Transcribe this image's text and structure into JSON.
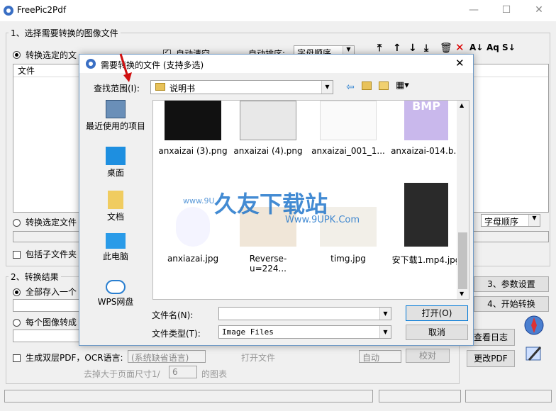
{
  "window": {
    "title": "FreePic2Pdf"
  },
  "section1": {
    "label": "1、选择需要转换的图像文件",
    "radio_selected": "转换选定的文",
    "auto_clear": "自动清空",
    "auto_sort_label": "自动排序:",
    "sort_value": "字母顺序",
    "file_column": "文件",
    "radio_folder": "转换选定文件",
    "include_subfolders": "包括子文件夹",
    "sort_value2": "字母顺序"
  },
  "section2": {
    "label": "2、转换结果",
    "all_into_one": "全部存入一个",
    "each_image": "每个图像转成",
    "dual_layer": "生成双层PDF，OCR语言:",
    "ocr_lang": "(系统缺省语言)",
    "open_file": "打开文件",
    "auto": "自动",
    "calibrate": "校对",
    "remove_larger": "去掉大于页面尺寸1/",
    "remove_value": "6",
    "remove_suffix": "的图表"
  },
  "buttons": {
    "params": "3、参数设置",
    "start": "4、开始转换",
    "log": "查看日志",
    "modify": "更改PDF"
  },
  "dialog": {
    "title": "需要转换的文件 (支持多选)",
    "lookin_label": "查找范围(I):",
    "lookin_value": "说明书",
    "places": [
      "最近使用的项目",
      "桌面",
      "文档",
      "此电脑",
      "WPS网盘"
    ],
    "files": [
      "anxaizai (3).png",
      "anxaizai (4).png",
      "anxaizai_001_1...",
      "anxaizai-014.b...",
      "anxiazai.jpg",
      "Reverse-u=224...",
      "timg.jpg",
      "安下载1.mp4.jpg"
    ],
    "bmp_badge": "BMP",
    "filename_label": "文件名(N):",
    "filename_value": "",
    "filetype_label": "文件类型(T):",
    "filetype_value": "Image Files",
    "open_button": "打开(O)",
    "cancel_button": "取消"
  },
  "watermark": {
    "main": "久友下载站",
    "sub": "Www.9UPK.Com",
    "left": "www.9U"
  }
}
